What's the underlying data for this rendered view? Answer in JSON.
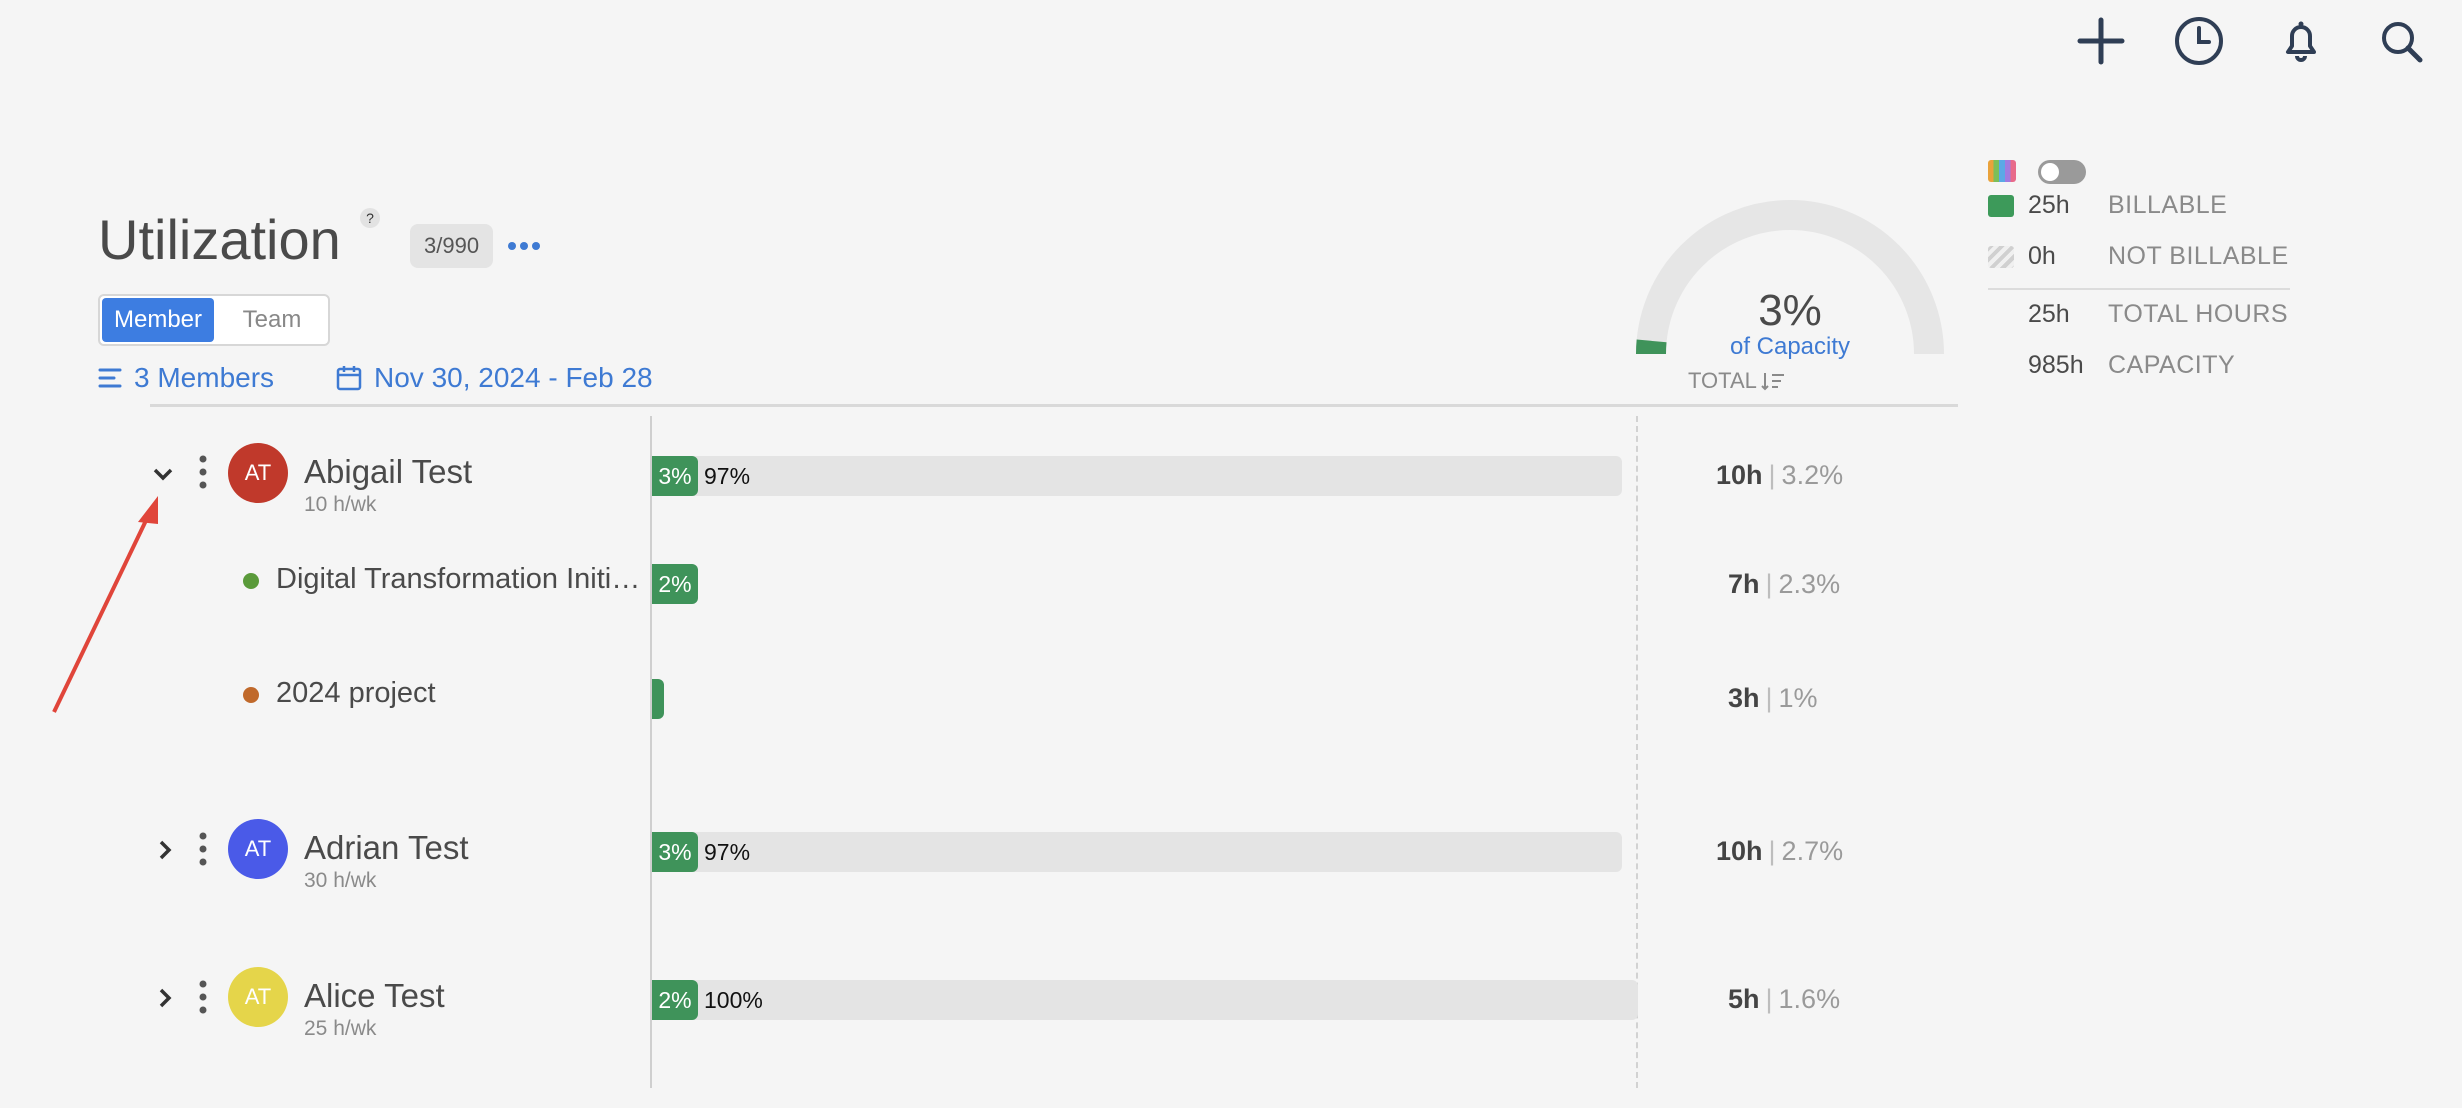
{
  "topbar": {
    "icons": [
      "plus-icon",
      "clock-icon",
      "bell-icon",
      "search-icon"
    ]
  },
  "header": {
    "title": "Utilization",
    "help": "?",
    "count": "3/990",
    "view_toggle": {
      "member": "Member",
      "team": "Team",
      "selected": "Member"
    },
    "members_filter": "3 Members",
    "date_range": "Nov 30, 2024 - Feb 28"
  },
  "gauge": {
    "percent": "3%",
    "caption": "of Capacity",
    "value_fraction": 0.03,
    "total_label": "TOTAL"
  },
  "legend": {
    "billable": {
      "value": "25h",
      "label": "BILLABLE"
    },
    "not_billable": {
      "value": "0h",
      "label": "NOT BILLABLE"
    },
    "total_hours": {
      "value": "25h",
      "label": "TOTAL HOURS"
    },
    "capacity": {
      "value": "985h",
      "label": "CAPACITY"
    }
  },
  "colors": {
    "accent": "#3d7de1",
    "billable": "#3f935a",
    "arrow": "#e0453a"
  },
  "members": [
    {
      "initials": "AT",
      "name": "Abigail Test",
      "hours_per_week": "10 h/wk",
      "avatar_color": "#c0392b",
      "expanded": true,
      "bar_used_label": "3%",
      "bar_rest_label": "97%",
      "used": 0.03,
      "total_hours": "10h",
      "total_pct": "3.2%",
      "projects": [
        {
          "name": "Digital Transformation Initiative",
          "dot_color": "#5a9a3a",
          "bar_label": "2%",
          "used": 0.02,
          "total_hours": "7h",
          "total_pct": "2.3%"
        },
        {
          "name": "2024 project",
          "dot_color": "#c0692b",
          "bar_label": "",
          "used": 0.01,
          "total_hours": "3h",
          "total_pct": "1%"
        }
      ]
    },
    {
      "initials": "AT",
      "name": "Adrian Test",
      "hours_per_week": "30 h/wk",
      "avatar_color": "#4a5ae8",
      "expanded": false,
      "bar_used_label": "3%",
      "bar_rest_label": "97%",
      "used": 0.03,
      "total_hours": "10h",
      "total_pct": "2.7%"
    },
    {
      "initials": "AT",
      "name": "Alice Test",
      "hours_per_week": "25 h/wk",
      "avatar_color": "#e5d54a",
      "expanded": false,
      "bar_used_label": "2%",
      "bar_rest_label": "100%",
      "used": 0.02,
      "total_hours": "5h",
      "total_pct": "1.6%"
    }
  ]
}
